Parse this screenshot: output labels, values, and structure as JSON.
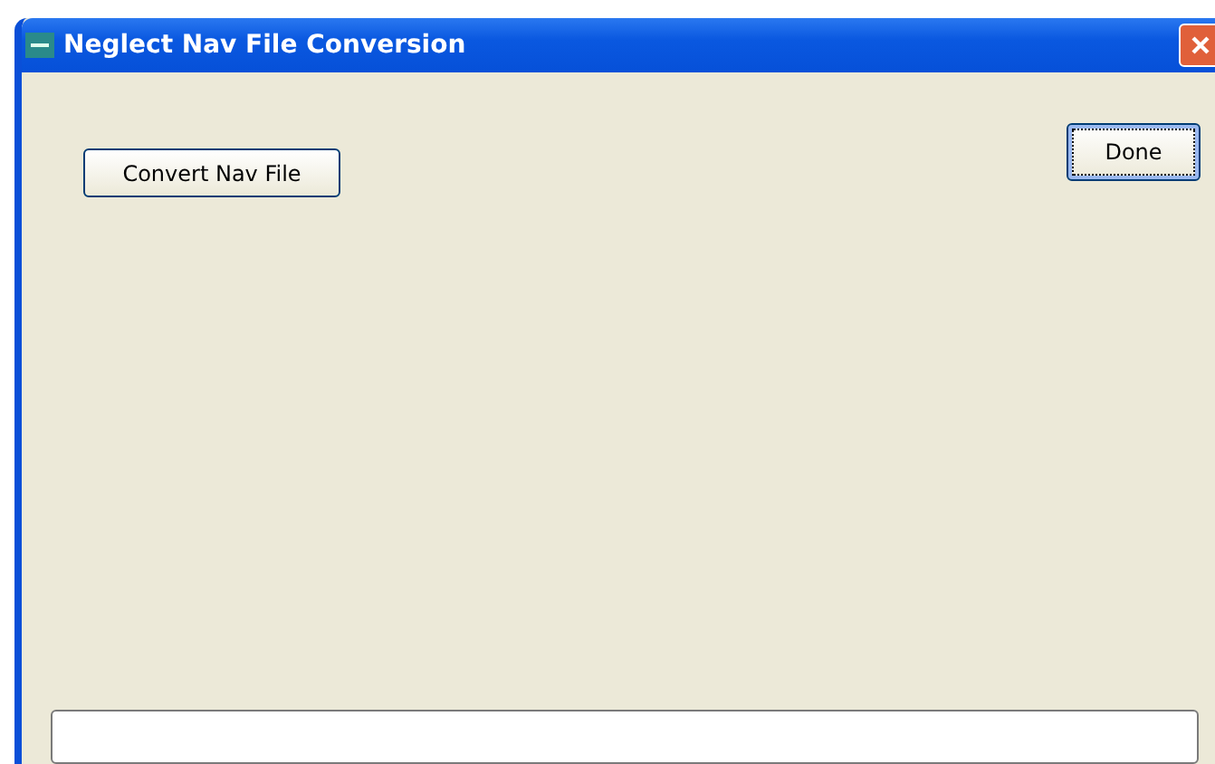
{
  "window": {
    "title": "Neglect Nav File Conversion"
  },
  "convert_button": {
    "label": "Convert Nav File"
  },
  "done_button": {
    "label": "Done",
    "focused": true
  }
}
